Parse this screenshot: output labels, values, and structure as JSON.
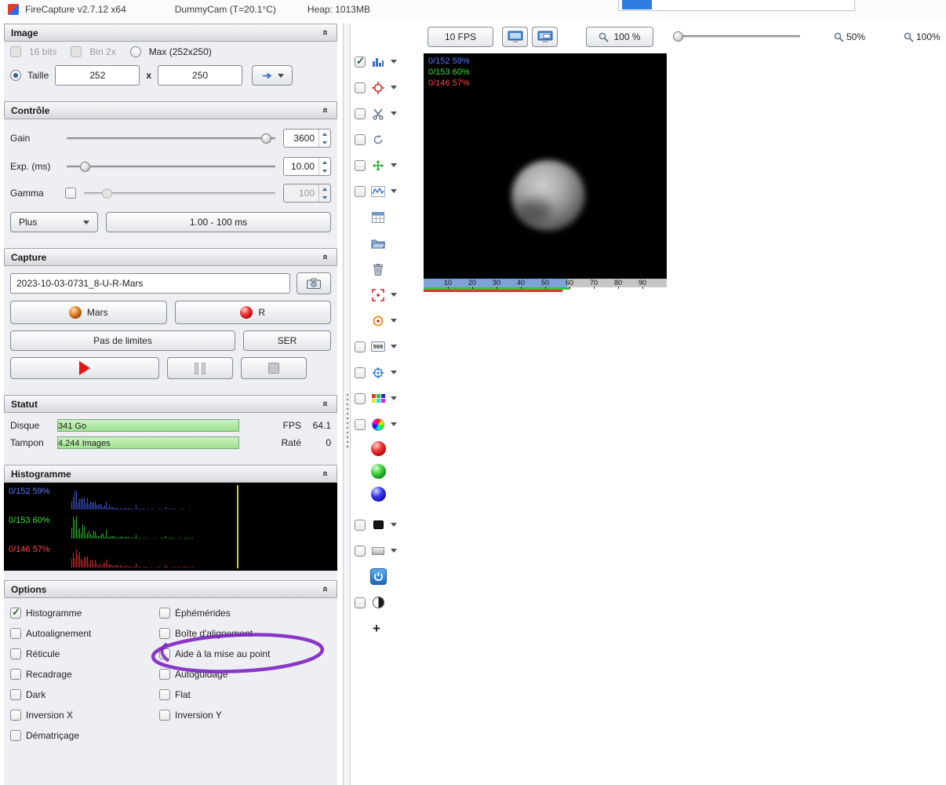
{
  "titlebar": {
    "app_title": "FireCapture v2.7.12 x64",
    "camera": "DummyCam (T=20.1°C)",
    "heap": "Heap: 1013MB"
  },
  "sections": {
    "image": {
      "title": "Image",
      "bits16_label": "16 bits",
      "bin2x_label": "Bin 2x",
      "max_label": "Max (252x250)",
      "taille_label": "Taille",
      "width_value": "252",
      "times_label": "x",
      "height_value": "250"
    },
    "controle": {
      "title": "Contrôle",
      "gain_label": "Gain",
      "gain_value": "3600",
      "exp_label": "Exp. (ms)",
      "exp_value": "10.00",
      "gamma_label": "Gamma",
      "gamma_value": "100",
      "plus_label": "Plus",
      "range_label": "1.00 - 100 ms"
    },
    "capture": {
      "title": "Capture",
      "filename": "2023-10-03-0731_8-U-R-Mars",
      "object_label": "Mars",
      "filter_label": "R",
      "limit_label": "Pas de limites",
      "format_label": "SER"
    },
    "statut": {
      "title": "Statut",
      "disque_label": "Disque",
      "disque_value": "341 Go",
      "fps_label": "FPS",
      "fps_value": "64.1",
      "tampon_label": "Tampon",
      "tampon_value": "4.244 Images",
      "rate_label": "Raté",
      "rate_value": "0"
    },
    "histogramme": {
      "title": "Histogramme",
      "channels": [
        {
          "label": "0/152 59%",
          "color": "#5b79ff",
          "bar_color": "#3c55cc",
          "pct": 59
        },
        {
          "label": "0/153 60%",
          "color": "#3ddc3d",
          "bar_color": "#27a827",
          "pct": 60
        },
        {
          "label": "0/146 57%",
          "color": "#ff4545",
          "bar_color": "#cc2a2a",
          "pct": 57
        }
      ],
      "marker_color": "#d3d300"
    },
    "options": {
      "title": "Options",
      "left": [
        {
          "label": "Histogramme",
          "checked": true
        },
        {
          "label": "Autoalignement",
          "checked": false
        },
        {
          "label": "Réticule",
          "checked": false
        },
        {
          "label": "Recadrage",
          "checked": false
        },
        {
          "label": "Dark",
          "checked": false
        },
        {
          "label": "Inversion X",
          "checked": false
        },
        {
          "label": "Dématriçage",
          "checked": false
        }
      ],
      "right": [
        {
          "label": "Éphémérides",
          "checked": false
        },
        {
          "label": "Boîte d'alignement",
          "checked": false
        },
        {
          "label": "Aide à la mise au point",
          "checked": false
        },
        {
          "label": "Autoguidage",
          "checked": false
        },
        {
          "label": "Flat",
          "checked": false
        },
        {
          "label": "Inversion Y",
          "checked": false
        }
      ],
      "annotation_color": "#7d22c3"
    }
  },
  "top_toolbar": {
    "fps_label": "10 FPS",
    "zoom_label": "100 %",
    "zoom_out_label": "50%",
    "zoom_in_label": "100%"
  },
  "side_toolbar": {
    "counter_label": "999",
    "add_label": "+",
    "checked": {
      "histogram": true
    }
  },
  "preview": {
    "scale_ticks": [
      "10",
      "20",
      "30",
      "40",
      "50",
      "60",
      "70",
      "80",
      "90"
    ],
    "scale_blue_pct": 59,
    "scale_green_pct": 60,
    "scale_red_pct": 57
  }
}
